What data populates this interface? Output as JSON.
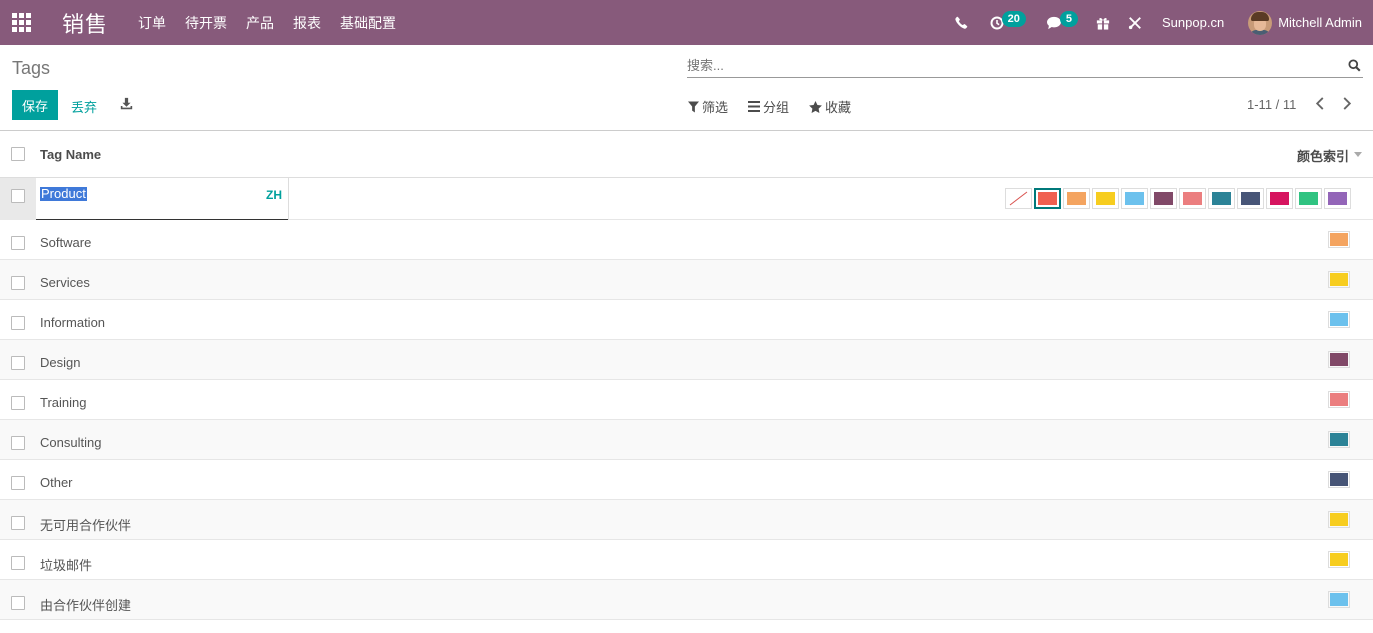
{
  "navbar": {
    "app_name": "销售",
    "menu": [
      "订单",
      "待开票",
      "产品",
      "报表",
      "基础配置"
    ],
    "activity_count": "20",
    "message_count": "5",
    "company": "Sunpop.cn",
    "user": "Mitchell Admin"
  },
  "control_panel": {
    "title": "Tags",
    "search_placeholder": "搜索...",
    "save_label": "保存",
    "discard_label": "丢弃",
    "filter_label": "筛选",
    "groupby_label": "分组",
    "favorites_label": "收藏",
    "pager": "1-11 / 11"
  },
  "table": {
    "col_name": "Tag Name",
    "col_color": "颜色索引",
    "edit_row": {
      "value": "Product",
      "lang": "ZH",
      "palette": [
        "none",
        "#f06050",
        "#f4a460",
        "#f7cd1f",
        "#6cc1ed",
        "#814968",
        "#eb7e7f",
        "#2c8397",
        "#475577",
        "#d6145f",
        "#30c381",
        "#9365b8"
      ],
      "selected_index": 1
    },
    "rows": [
      {
        "name": "Software",
        "color": "#f4a460"
      },
      {
        "name": "Services",
        "color": "#f7cd1f"
      },
      {
        "name": "Information",
        "color": "#6cc1ed"
      },
      {
        "name": "Design",
        "color": "#814968"
      },
      {
        "name": "Training",
        "color": "#eb7e7f"
      },
      {
        "name": "Consulting",
        "color": "#2c8397"
      },
      {
        "name": "Other",
        "color": "#475577"
      },
      {
        "name": "无可用合作伙伴",
        "color": "#f7cd1f"
      },
      {
        "name": "垃圾邮件",
        "color": "#f7cd1f"
      },
      {
        "name": "由合作伙伴创建",
        "color": "#6cc1ed"
      }
    ]
  },
  "colors": {
    "brand": "#875a7b",
    "accent": "#00a09d"
  }
}
